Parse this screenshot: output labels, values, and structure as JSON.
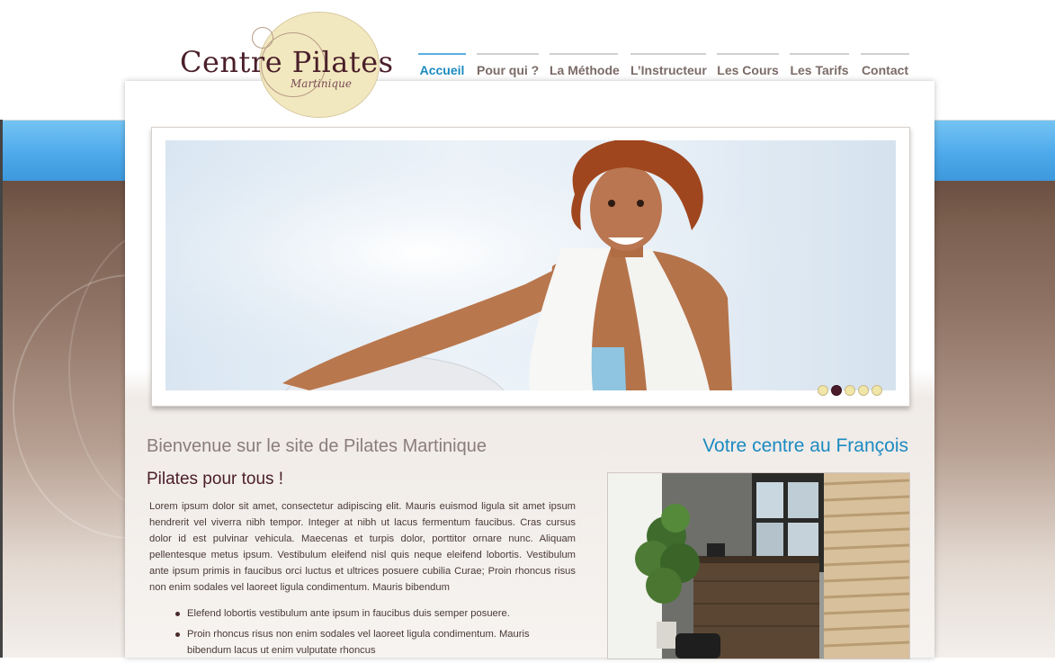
{
  "logo": {
    "title": "Centre Pilates",
    "subtitle": "Martinique"
  },
  "nav": {
    "items": [
      {
        "label": "Accueil",
        "active": true
      },
      {
        "label": "Pour qui ?",
        "active": false
      },
      {
        "label": "La Méthode",
        "active": false
      },
      {
        "label": "L’Instructeur",
        "active": false
      },
      {
        "label": "Les Cours",
        "active": false
      },
      {
        "label": "Les Tarifs",
        "active": false
      },
      {
        "label": "Contact",
        "active": false
      }
    ]
  },
  "slider": {
    "dot_count": 5,
    "active_dot": 2
  },
  "main": {
    "welcome": "Bienvenue sur le site de Pilates Martinique",
    "subheading": "Pilates pour tous !",
    "paragraph": "Lorem ipsum dolor sit amet, consectetur adipiscing elit. Mauris euismod ligula sit amet ipsum hendrerit vel viverra nibh tempor. Integer at nibh ut lacus fermentum faucibus. Cras cursus dolor id est pulvinar vehicula. Maecenas et turpis dolor, porttitor ornare nunc. Aliquam pellentesque metus ipsum. Vestibulum eleifend nisl quis neque eleifend lobortis. Vestibulum ante ipsum primis in faucibus orci luctus et ultrices posuere cubilia Curae; Proin rhoncus risus non enim sodales vel laoreet ligula condimentum. Mauris bibendum",
    "bullets": [
      "Elefend lobortis vestibulum ante ipsum in faucibus duis semper posuere.",
      "Proin rhoncus risus non enim sodales vel laoreet ligula condimentum. Mauris bibendum lacus ut enim vulputate rhoncus"
    ]
  },
  "sidebar": {
    "title": "Votre centre au François"
  },
  "colors": {
    "accent_blue": "#1b8ac0",
    "brand_burgundy": "#4a1d2a",
    "logo_cream": "#f2e8bf"
  }
}
